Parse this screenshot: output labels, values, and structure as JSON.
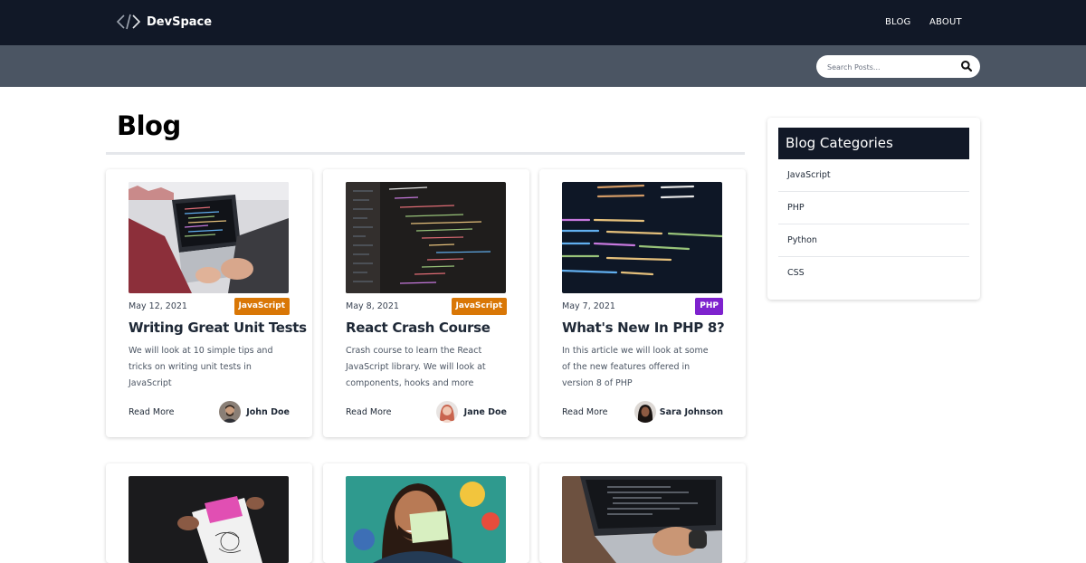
{
  "brand": {
    "name": "DevSpace"
  },
  "nav": {
    "items": [
      "BLOG",
      "ABOUT"
    ]
  },
  "search": {
    "placeholder": "Search Posts..."
  },
  "page": {
    "title": "Blog"
  },
  "posts": [
    {
      "date": "May 12, 2021",
      "category": "JavaScript",
      "category_color": "#d97706",
      "title": "Writing Great Unit Tests",
      "excerpt": "We will look at 10 simple tips and tricks on writing unit tests in JavaScript",
      "read_more": "Read More",
      "author": "John Doe"
    },
    {
      "date": "May 8, 2021",
      "category": "JavaScript",
      "category_color": "#d97706",
      "title": "React Crash Course",
      "excerpt": "Crash course to learn the React JavaScript library. We will look at components, hooks and more",
      "read_more": "Read More",
      "author": "Jane Doe"
    },
    {
      "date": "May 7, 2021",
      "category": "PHP",
      "category_color": "#7e22ce",
      "title": "What's New In PHP 8?",
      "excerpt": "In this article we will look at some of the new features offered in version 8 of PHP",
      "read_more": "Read More",
      "author": "Sara Johnson"
    }
  ],
  "sidebar": {
    "title": "Blog Categories",
    "categories": [
      "JavaScript",
      "PHP",
      "Python",
      "CSS"
    ]
  },
  "colors": {
    "header": "#111827",
    "searchbar": "#4b5563",
    "javascript": "#d97706",
    "php": "#7e22ce"
  }
}
